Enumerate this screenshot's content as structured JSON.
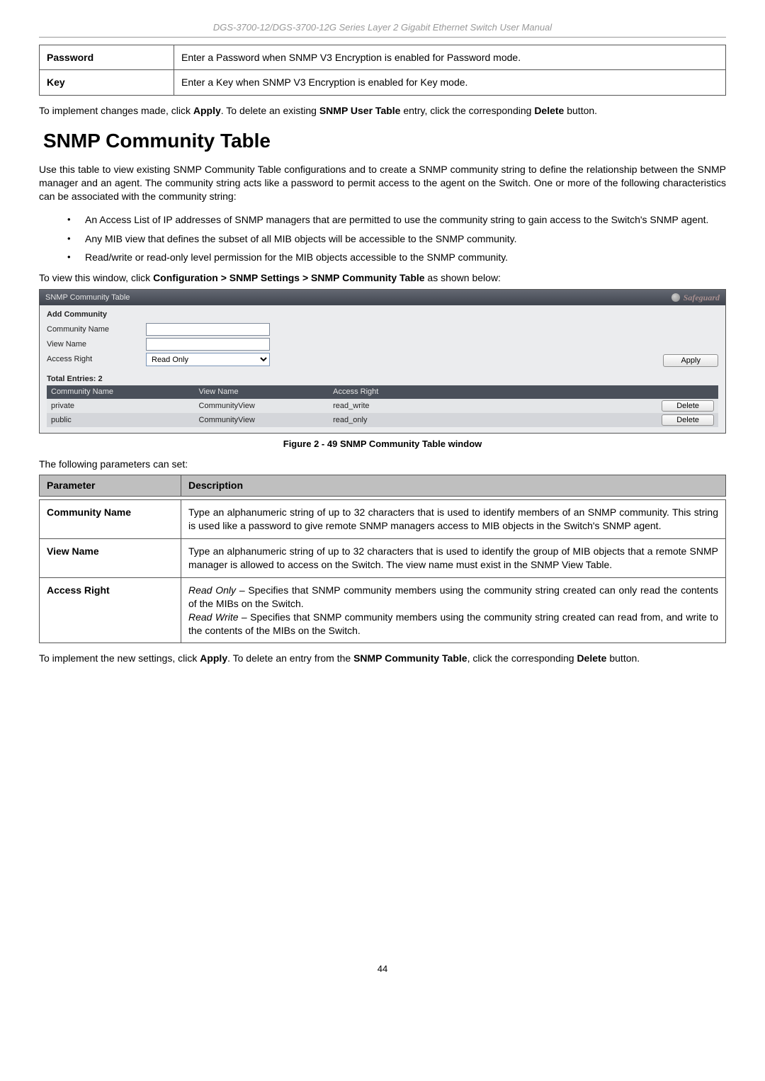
{
  "header": {
    "manual_title": "DGS-3700-12/DGS-3700-12G Series Layer 2 Gigabit Ethernet Switch User Manual"
  },
  "top_table": {
    "rows": [
      {
        "param": "Password",
        "desc": "Enter a Password when SNMP V3 Encryption is enabled for Password mode."
      },
      {
        "param": "Key",
        "desc": "Enter a Key when SNMP V3 Encryption is enabled for Key mode."
      }
    ]
  },
  "para1_parts": {
    "p1": "To implement changes made, click ",
    "p2": "Apply",
    "p3": ". To delete an existing ",
    "p4": "SNMP User Table",
    "p5": " entry, click the corresponding ",
    "p6": "Delete",
    "p7": " button."
  },
  "section_title": "SNMP Community Table",
  "para2": "Use this table to view existing SNMP Community Table configurations and to create a SNMP community string to define the relationship between the SNMP manager and an agent. The community string acts like a password to permit access to the agent on the Switch. One or more of the following characteristics can be associated with the community string:",
  "bullets": [
    "An Access List of IP addresses of SNMP managers that are permitted to use the community string to gain access to the Switch's SNMP agent.",
    "Any MIB view that defines the subset of all MIB objects will be accessible to the SNMP community.",
    "Read/write or read-only level permission for the MIB objects accessible to the SNMP community."
  ],
  "nav_line": {
    "p1": "To view this window, click ",
    "p2": "Configuration > SNMP Settings > SNMP Community Table",
    "p3": " as shown below:"
  },
  "panel": {
    "title": "SNMP Community Table",
    "safeguard": "Safeguard",
    "add_community": "Add Community",
    "labels": {
      "community_name": "Community Name",
      "view_name": "View Name",
      "access_right": "Access Right"
    },
    "access_right_value": "Read Only",
    "apply_label": "Apply",
    "total_entries": "Total Entries: 2",
    "cols": {
      "c1": "Community Name",
      "c2": "View Name",
      "c3": "Access Right"
    },
    "rows": [
      {
        "community": "private",
        "view": "CommunityView",
        "access": "read_write",
        "btn": "Delete"
      },
      {
        "community": "public",
        "view": "CommunityView",
        "access": "read_only",
        "btn": "Delete"
      }
    ]
  },
  "figure_caption": "Figure 2 - 49 SNMP Community Table window",
  "params_intro": "The following parameters can set:",
  "param_header": {
    "c1": "Parameter",
    "c2": "Description"
  },
  "param_rows": {
    "r1": {
      "name": "Community Name",
      "desc": "Type an alphanumeric string of up to 32 characters that is used to identify members of an SNMP community. This string is used like a password to give remote SNMP managers access to MIB objects in the Switch's SNMP agent."
    },
    "r2": {
      "name": "View Name",
      "desc": "Type an alphanumeric string of up to 32 characters that is used to identify the group of MIB objects that a remote SNMP manager is allowed to access on the Switch. The view name must exist in the SNMP View Table."
    },
    "r3": {
      "name": "Access Right",
      "ro_label": "Read Only",
      "ro_text": " – Specifies that SNMP community members using the community string created can only read the contents of the MIBs on the Switch.",
      "rw_label": "Read Write",
      "rw_text": " – Specifies that SNMP community members using the community string created can read from, and write to the contents of the MIBs on the Switch."
    }
  },
  "para3_parts": {
    "p1": "To implement the new settings, click ",
    "p2": "Apply",
    "p3": ". To delete an entry from the ",
    "p4": "SNMP Community Table",
    "p5": ", click the corresponding ",
    "p6": "Delete",
    "p7": " button."
  },
  "page_number": "44"
}
